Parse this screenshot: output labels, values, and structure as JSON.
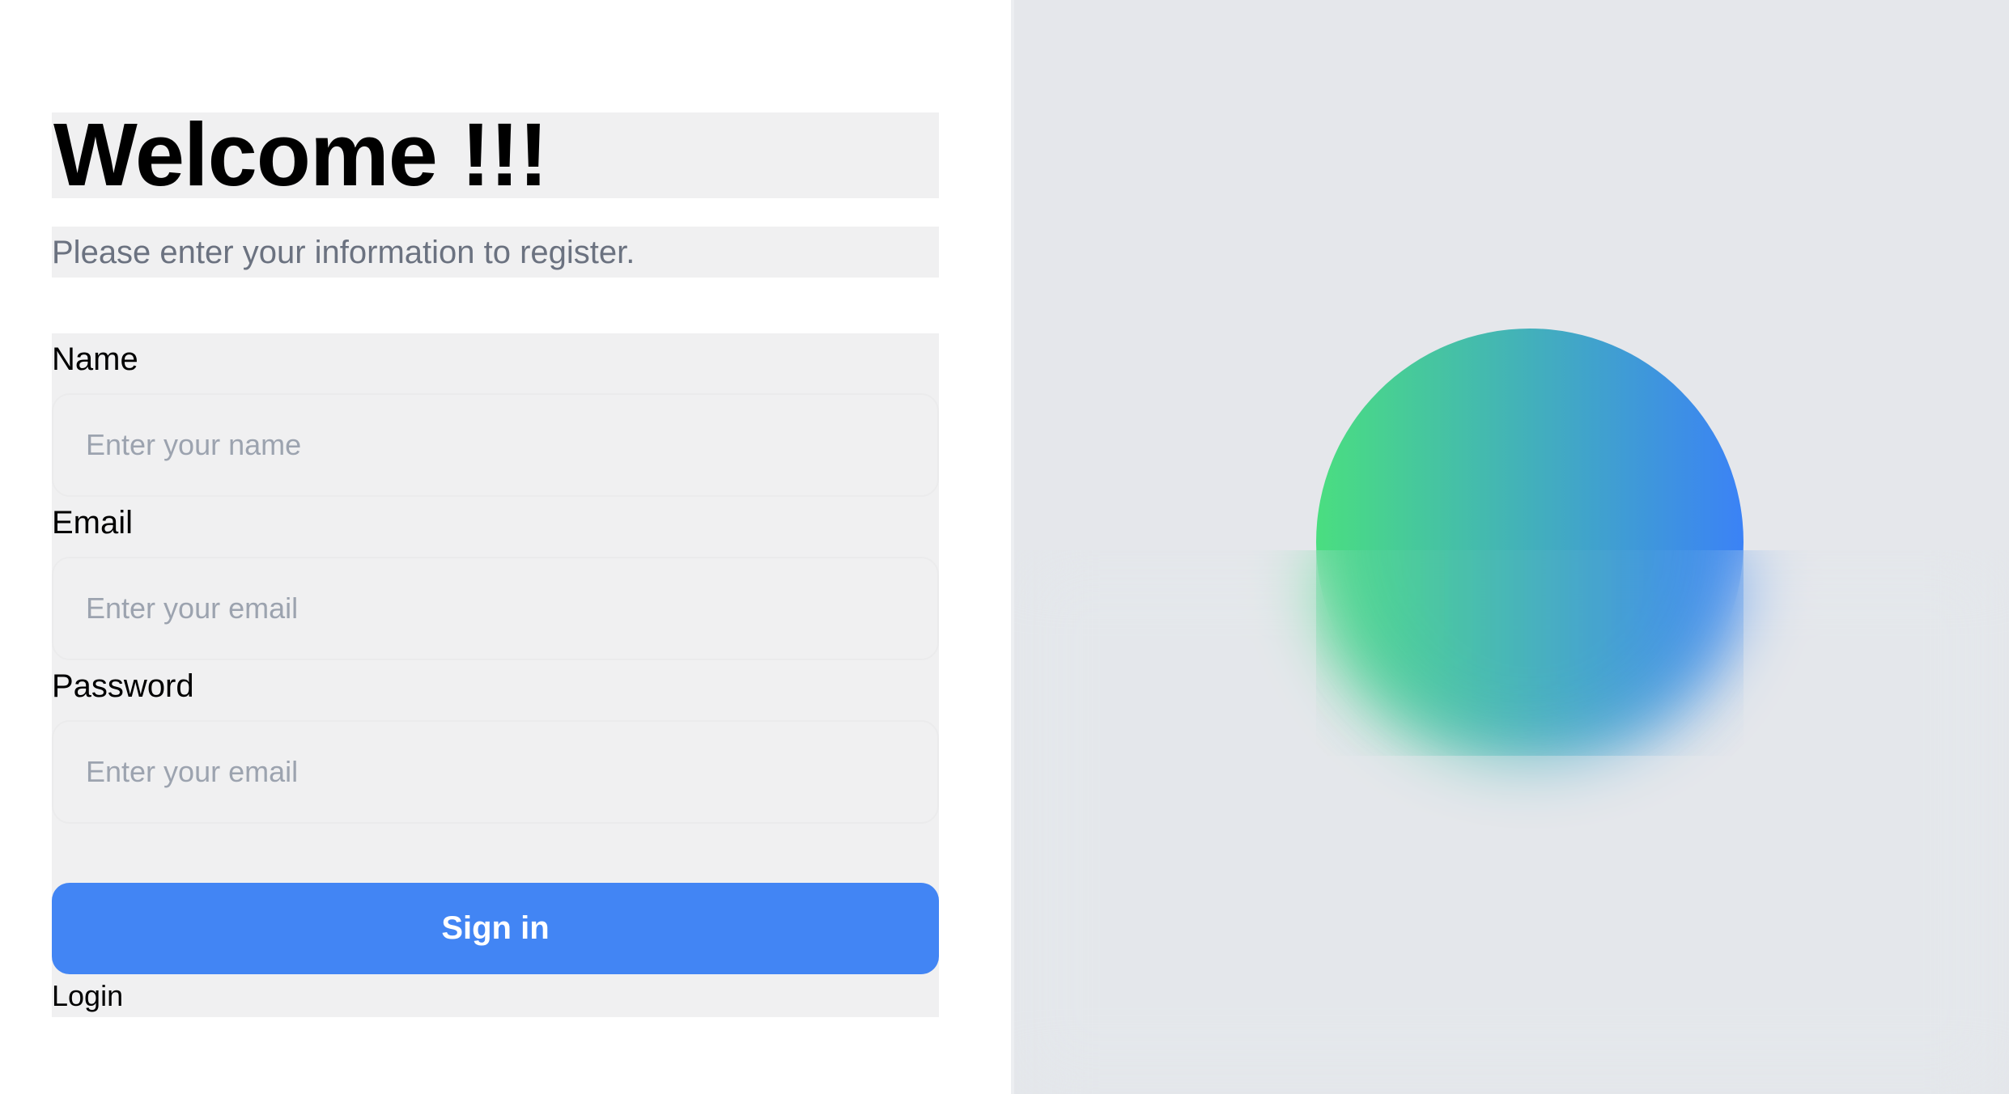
{
  "header": {
    "title": "Welcome !!!",
    "subtitle": "Please enter your information to register."
  },
  "form": {
    "name": {
      "label": "Name",
      "placeholder": "Enter your name",
      "value": ""
    },
    "email": {
      "label": "Email",
      "placeholder": "Enter your email",
      "value": ""
    },
    "password": {
      "label": "Password",
      "placeholder": "Enter your email",
      "value": ""
    },
    "submit_label": "Sign in",
    "login_link": "Login"
  },
  "decoration": {
    "orb_gradient_start": "#4ade80",
    "orb_gradient_end": "#3b82f6",
    "panel_background": "#e5e7eb",
    "accent_button": "#4285f4"
  }
}
